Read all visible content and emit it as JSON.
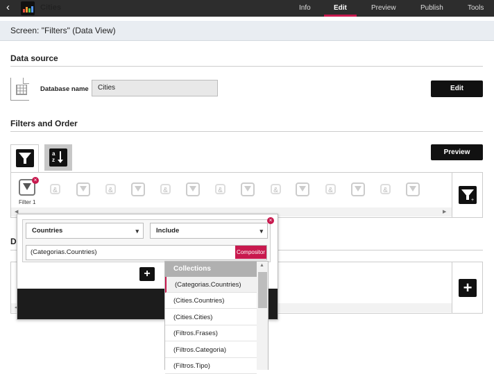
{
  "topbar": {
    "app_title": "Cities",
    "tabs": [
      {
        "label": "Info"
      },
      {
        "label": "Edit"
      },
      {
        "label": "Preview"
      },
      {
        "label": "Publish"
      },
      {
        "label": "Tools"
      }
    ],
    "active_tab": "Edit"
  },
  "screen": {
    "title": "Screen: \"Filters\" (Data View)"
  },
  "data_source": {
    "section_title": "Data source",
    "db_label": "Database name",
    "db_value": "Cities",
    "edit_label": "Edit"
  },
  "filters": {
    "section_title": "Filters and Order",
    "preview_label": "Preview",
    "filter1_label": "Filter 1",
    "amp_symbol": "&"
  },
  "lower_section": {
    "title_initial": "D"
  },
  "popup": {
    "field_select": "Countries",
    "mode_select": "Include",
    "expression": "(Categorias.Countries)",
    "compositor_label": "Compositor",
    "add_symbol": "+"
  },
  "dropdown": {
    "header": "Collections",
    "items": [
      {
        "label": "(Categorias.Countries)"
      },
      {
        "label": "(Cities.Countries)"
      },
      {
        "label": "(Cities.Cities)"
      },
      {
        "label": "(Filtros.Frases)"
      },
      {
        "label": "(Filtros.Categoria)"
      },
      {
        "label": "(Filtros.Tipo)"
      }
    ],
    "selected_index": 0
  },
  "colors": {
    "accent": "#c8194e",
    "dark": "#111111",
    "topbar": "#2d2d2d"
  }
}
